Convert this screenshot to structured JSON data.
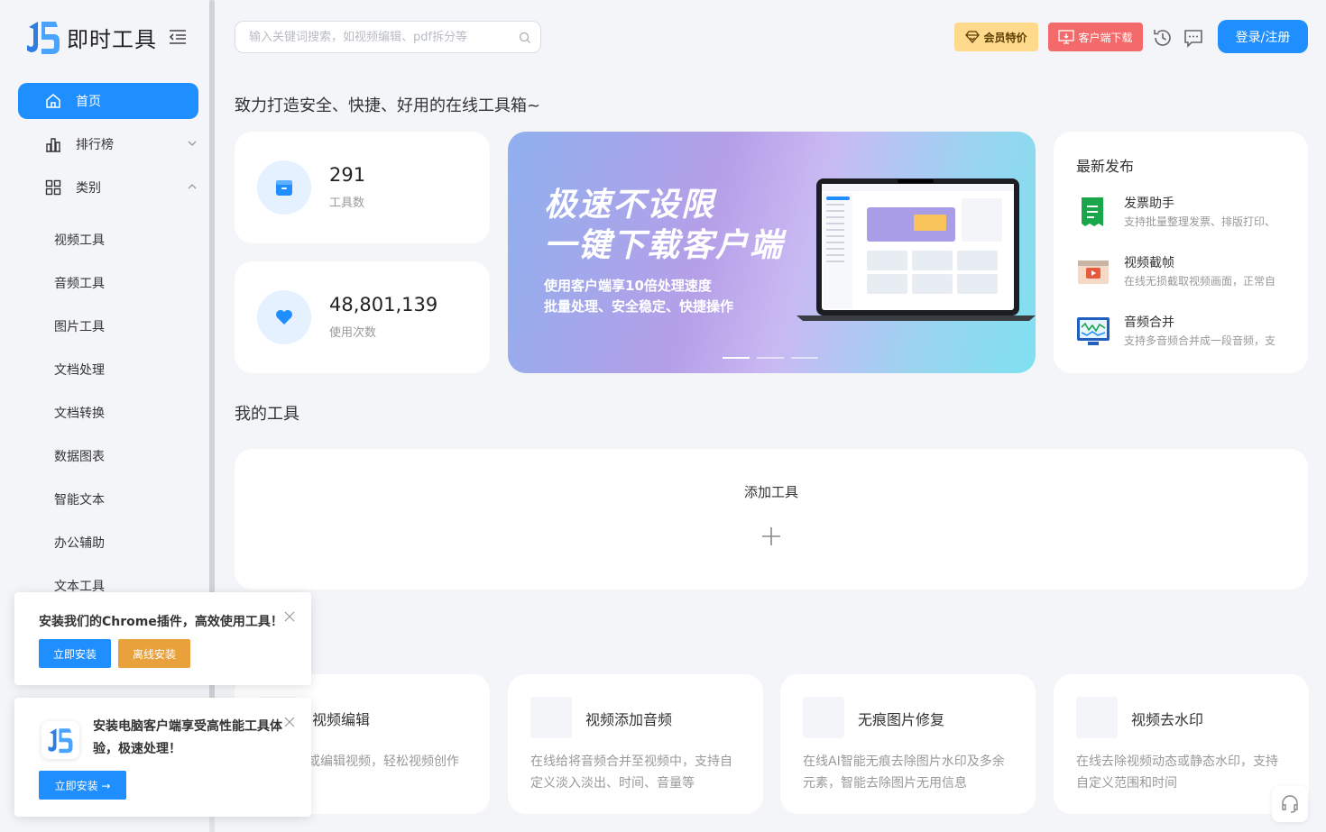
{
  "app": {
    "logo_text": "即时工具"
  },
  "sidebar": {
    "nav": [
      {
        "label": "首页",
        "active": true
      },
      {
        "label": "排行榜"
      },
      {
        "label": "类别"
      }
    ],
    "categories": [
      "视频工具",
      "音频工具",
      "图片工具",
      "文档处理",
      "文档转换",
      "数据图表",
      "智能文本",
      "办公辅助",
      "文本工具"
    ]
  },
  "header": {
    "search_placeholder": "输入关键词搜索，如视频编辑、pdf拆分等",
    "vip_label": "会员特价",
    "client_label": "客户端下载",
    "login_label": "登录/注册"
  },
  "slogan": "致力打造安全、快捷、好用的在线工具箱~",
  "stats": [
    {
      "value": "291",
      "label": "工具数"
    },
    {
      "value": "48,801,139",
      "label": "使用次数"
    }
  ],
  "banner": {
    "title_line1": "极速不设限",
    "title_line2": "一键下载客户端",
    "sub_line1": "使用客户端享10倍处理速度",
    "sub_line2": "批量处理、安全稳定、快捷操作",
    "slide_count": 3,
    "active_slide": 0
  },
  "latest": {
    "title": "最新发布",
    "items": [
      {
        "name": "发票助手",
        "desc": "支持批量整理发票、排版打印、",
        "icon": "invoice-icon"
      },
      {
        "name": "视频截帧",
        "desc": "在线无损截取视频画面，正常自",
        "icon": "video-frame-icon"
      },
      {
        "name": "音频合并",
        "desc": "支持多音频合并成一段音频，支",
        "icon": "audio-merge-icon"
      }
    ]
  },
  "my_tools": {
    "title": "我的工具",
    "add_label": "添加工具"
  },
  "tools": [
    {
      "name": "视频编辑",
      "desc": "在线裁剪或编辑视频，轻松视频创作",
      "visible_desc": "的在线裁剪或编辑视频，轻\n频创作"
    },
    {
      "name": "视频添加音频",
      "desc": "在线给将音频合并至视频中，支持自定义淡入淡出、时间、音量等"
    },
    {
      "name": "无痕图片修复",
      "desc": "在线AI智能无痕去除图片水印及多余元素，智能去除图片无用信息"
    },
    {
      "name": "视频去水印",
      "desc": "在线去除视频动态或静态水印，支持自定义范围和时间"
    }
  ],
  "popups": {
    "chrome": {
      "text": "安装我们的Chrome插件，高效使用工具！",
      "install_label": "立即安装",
      "offline_label": "离线安装"
    },
    "desktop": {
      "text": "安装电脑客户端享受高性能工具体验，极速处理！",
      "install_label": "立即安装 →"
    }
  },
  "colors": {
    "primary": "#1f8fff",
    "vip": "#ffd98c",
    "client": "#f46a6a",
    "offline": "#e9a23b",
    "background": "#f3f5f9"
  }
}
